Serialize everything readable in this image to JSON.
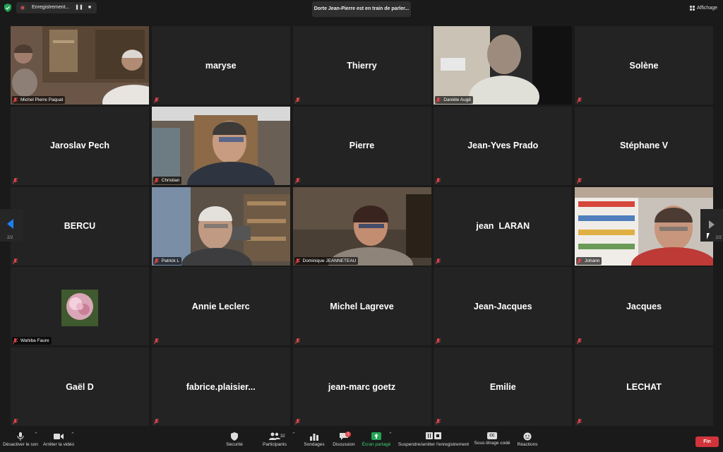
{
  "topbar": {
    "recording_label": "Enregistrement...",
    "pause_label": "❚❚",
    "stop_label": "■",
    "speaker_notice": "Dorte Jean-Pierre est en train de parler...",
    "view_label": "Affichage"
  },
  "nav": {
    "left_page": "2/2",
    "right_page": "2/2"
  },
  "tiles": [
    {
      "name": "Michel Pierre Paquat",
      "video": true
    },
    {
      "name": "maryse",
      "video": false
    },
    {
      "name": "Thierry",
      "video": false
    },
    {
      "name": "Danièle Augé",
      "video": true
    },
    {
      "name": "Solène",
      "video": false
    },
    {
      "name": "Jaroslav Pech",
      "video": false
    },
    {
      "name": "Christian",
      "video": true
    },
    {
      "name": "Pierre",
      "video": false
    },
    {
      "name": "Jean-Yves Prado",
      "video": false
    },
    {
      "name": "Stéphane V",
      "video": false
    },
    {
      "name": "BERCU",
      "video": false
    },
    {
      "name": "Patrick L",
      "video": true
    },
    {
      "name": "Dominique JEANNETEAU",
      "video": true
    },
    {
      "name": "jean  LARAN",
      "video": false
    },
    {
      "name": "Johann",
      "video": true
    },
    {
      "name": "Wahiba Faure",
      "video": true
    },
    {
      "name": "Annie Leclerc",
      "video": false
    },
    {
      "name": "Michel Lagreve",
      "video": false
    },
    {
      "name": "Jean-Jacques",
      "video": false
    },
    {
      "name": "Jacques",
      "video": false
    },
    {
      "name": "Gaël D",
      "video": false
    },
    {
      "name": "fabrice.plaisier...",
      "video": false
    },
    {
      "name": "jean-marc goetz",
      "video": false
    },
    {
      "name": "Emilie",
      "video": false
    },
    {
      "name": "LECHAT",
      "video": false
    }
  ],
  "toolbar": {
    "mute": "Désactiver le son",
    "video": "Arrêter la vidéo",
    "security": "Sécurité",
    "participants": "Participants",
    "participants_count": "32",
    "polls": "Sondages",
    "chat": "Discussion",
    "chat_badge": "1",
    "share": "Écran partagé",
    "record": "Suspendre/arrêter l'enregistrement",
    "captions": "Sous-titrage codé",
    "captions_icon_text": "CC",
    "reactions": "Réactions",
    "end": "Fin"
  },
  "colors": {
    "background": "#1a1a1a",
    "tile": "#232323",
    "muted_icon": "#e0474c",
    "share_green": "#23a455",
    "end_red": "#d1343b",
    "nav_blue": "#1e7ef7"
  }
}
